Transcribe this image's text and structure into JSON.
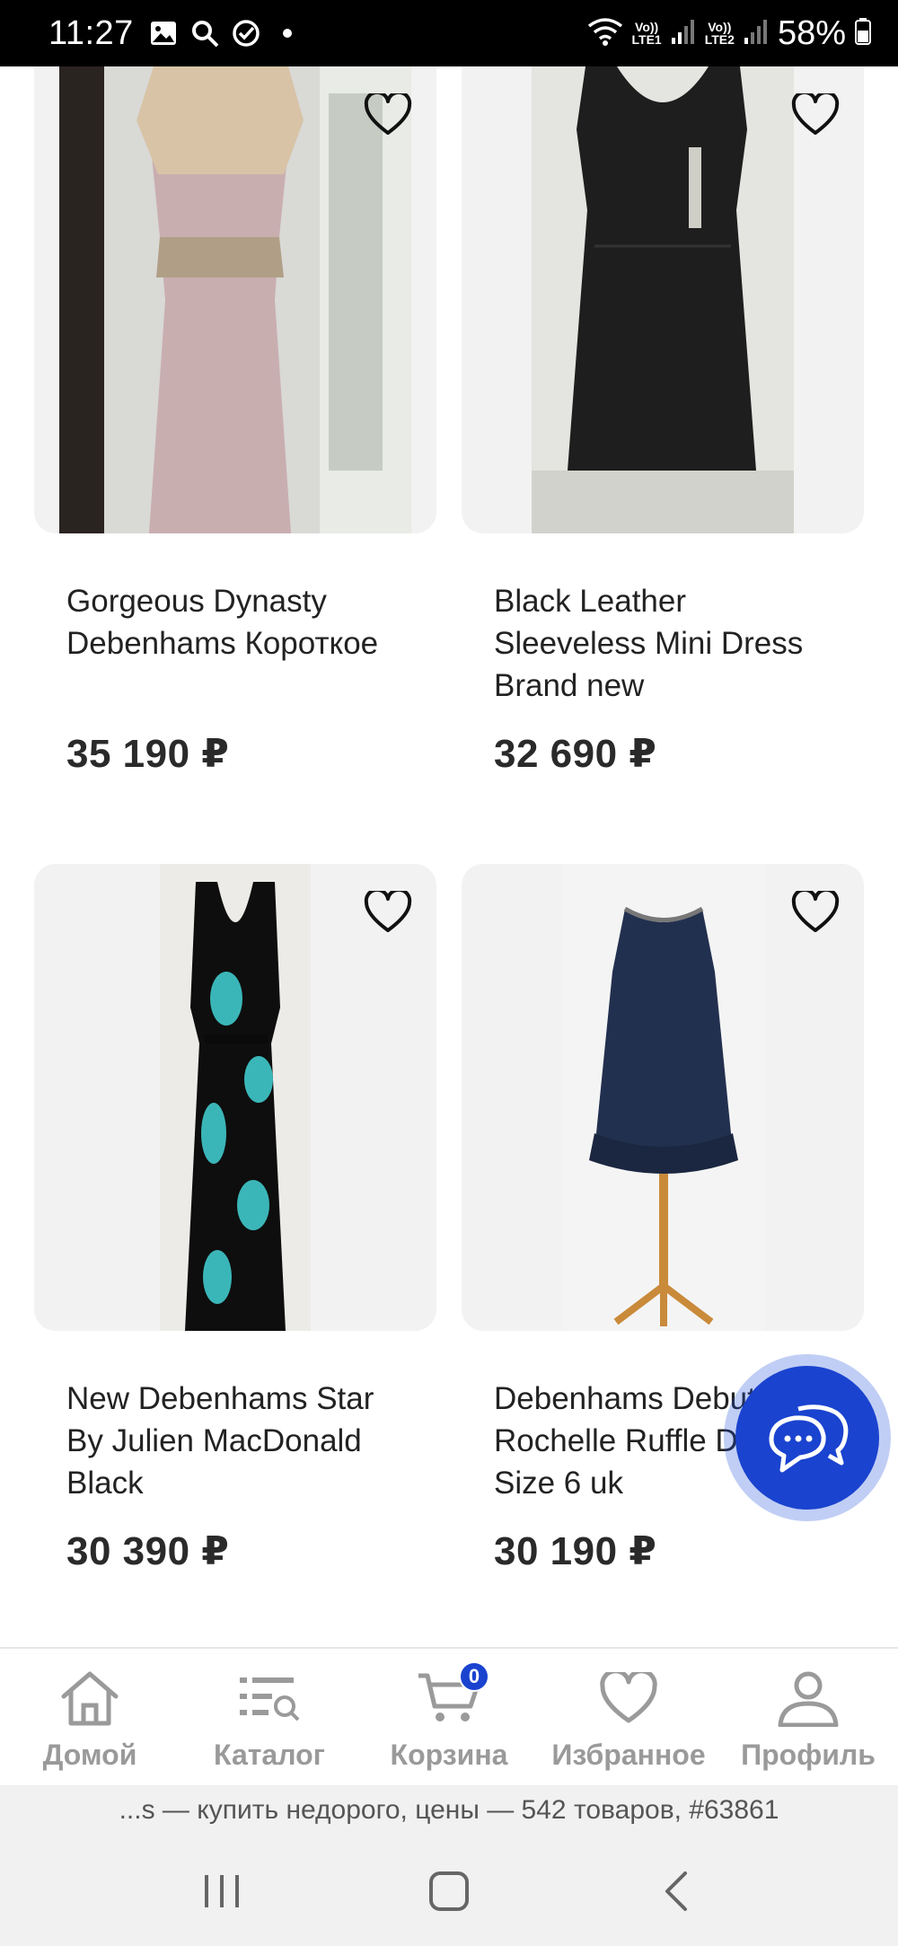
{
  "status_bar": {
    "time": "11:27",
    "sim1_label": "LTE1",
    "sim2_label": "LTE2",
    "volte1": "Vo))",
    "volte2": "Vo))",
    "battery": "58%"
  },
  "products": [
    {
      "title": "Gorgeous Dynasty Debenhams Короткое",
      "price": "35 190 ₽"
    },
    {
      "title": "Black Leather Sleeveless Mini Dress Brand new",
      "price": "32 690 ₽"
    },
    {
      "title": "New Debenhams Star By Julien MacDonald Black",
      "price": "30 390 ₽"
    },
    {
      "title": "Debenhams Debut Rochelle Ruffle Dress Size 6 uk",
      "price": "30 190 ₽"
    }
  ],
  "bottom_nav": {
    "home": "Домой",
    "catalog": "Каталог",
    "cart": "Корзина",
    "cart_count": "0",
    "favorites": "Избранное",
    "profile": "Профиль"
  },
  "page_title": "...s — купить недорого, цены — 542 товаров, #63861",
  "icons": {
    "favorite": "heart-outline-icon",
    "chat": "chat-bubbles-icon"
  },
  "colors": {
    "accent": "#1a43cf",
    "nav_inactive": "#9a9a9a"
  }
}
